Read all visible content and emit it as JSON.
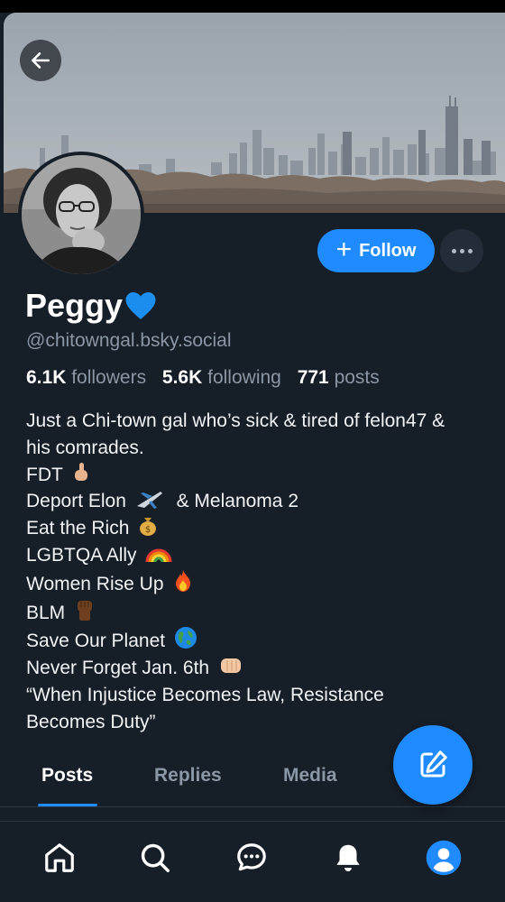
{
  "profile": {
    "display_name": "Peggy",
    "name_emoji": "blue-heart",
    "handle": "@chitowngal.bsky.social",
    "avatar": "profile-photo"
  },
  "actions": {
    "follow_label": "Follow",
    "more_icon": "ellipsis-icon"
  },
  "stats": {
    "followers_count": "6.1K",
    "followers_label": "followers",
    "following_count": "5.6K",
    "following_label": "following",
    "posts_count": "771",
    "posts_label": "posts"
  },
  "bio": {
    "line1": "Just a Chi-town gal who’s sick & tired of felon47 & his comrades.",
    "line2": "FDT",
    "line3a": "Deport Elon",
    "line3b": "& Melanoma 2",
    "line4": "Eat the Rich",
    "line5": "LGBTQA Ally",
    "line6": "Women Rise Up",
    "line7": "BLM",
    "line8": "Save Our Planet",
    "line9": "Never Forget Jan. 6th",
    "line10": "“When Injustice Becomes Law, Resistance Becomes Duty”"
  },
  "tabs": [
    {
      "label": "Posts",
      "active": true
    },
    {
      "label": "Replies",
      "active": false
    },
    {
      "label": "Media",
      "active": false
    }
  ],
  "nav": [
    "home-icon",
    "search-icon",
    "chat-icon",
    "bell-icon",
    "profile-icon"
  ],
  "colors": {
    "background": "#161e27",
    "accent": "#208bfe",
    "muted_text": "#8a97a6"
  }
}
